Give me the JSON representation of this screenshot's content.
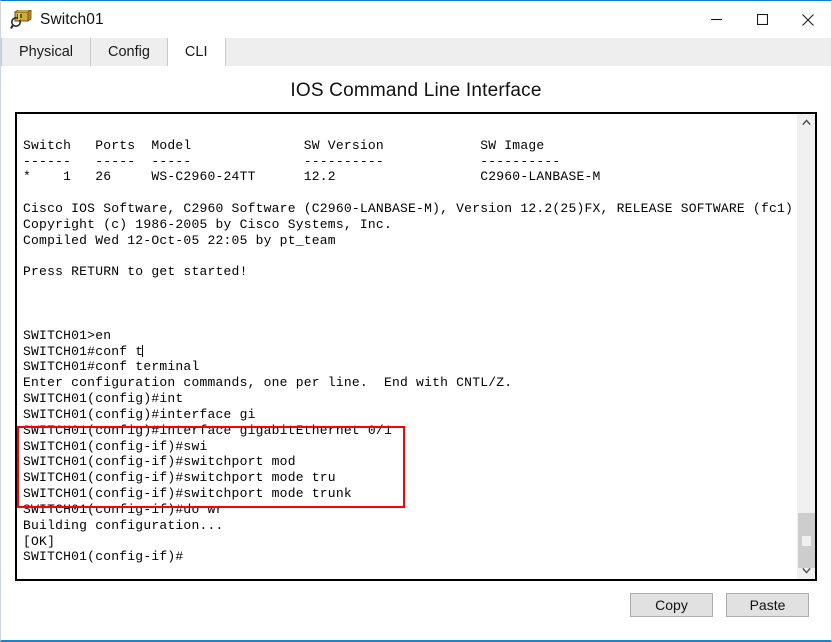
{
  "window": {
    "title": "Switch01",
    "icon": "switch-device-icon",
    "accent_color": "#1b85c9",
    "controls": {
      "minimize": "minimize-icon",
      "maximize": "maximize-icon",
      "close": "close-icon"
    }
  },
  "tabs": [
    {
      "label": "Physical",
      "active": false
    },
    {
      "label": "Config",
      "active": false
    },
    {
      "label": "CLI",
      "active": true
    }
  ],
  "panel": {
    "title": "IOS Command Line Interface"
  },
  "terminal": {
    "highlight_color": "#fb0007",
    "text": "\nSwitch   Ports  Model              SW Version            SW Image\n------   -----  -----              ----------            ----------\n*    1   26     WS-C2960-24TT      12.2                  C2960-LANBASE-M\n\nCisco IOS Software, C2960 Software (C2960-LANBASE-M), Version 12.2(25)FX, RELEASE SOFTWARE (fc1)\nCopyright (c) 1986-2005 by Cisco Systems, Inc.\nCompiled Wed 12-Oct-05 22:05 by pt_team\n\nPress RETURN to get started!\n\n\n\nSWITCH01>en\nSWITCH01#conf t",
    "text_after_cursor": "\nSWITCH01#conf terminal\nEnter configuration commands, one per line.  End with CNTL/Z.\nSWITCH01(config)#int\nSWITCH01(config)#interface gi\nSWITCH01(config)#interface gigabitEthernet 0/1\nSWITCH01(config-if)#swi\nSWITCH01(config-if)#switchport mod\nSWITCH01(config-if)#switchport mode tru\nSWITCH01(config-if)#switchport mode trunk\nSWITCH01(config-if)#do wr\nBuilding configuration...\n[OK]\nSWITCH01(config-if)#",
    "highlighted_lines": [
      "SWITCH01(config)#interface gigabitEthernet 0/1",
      "SWITCH01(config-if)#swi",
      "SWITCH01(config-if)#switchport mod",
      "SWITCH01(config-if)#switchport mode tru",
      "SWITCH01(config-if)#switchport mode trunk"
    ],
    "scrollbar": {
      "up_arrow": "chevron-up-icon",
      "down_arrow": "chevron-down-icon"
    }
  },
  "footer": {
    "copy_label": "Copy",
    "paste_label": "Paste"
  }
}
